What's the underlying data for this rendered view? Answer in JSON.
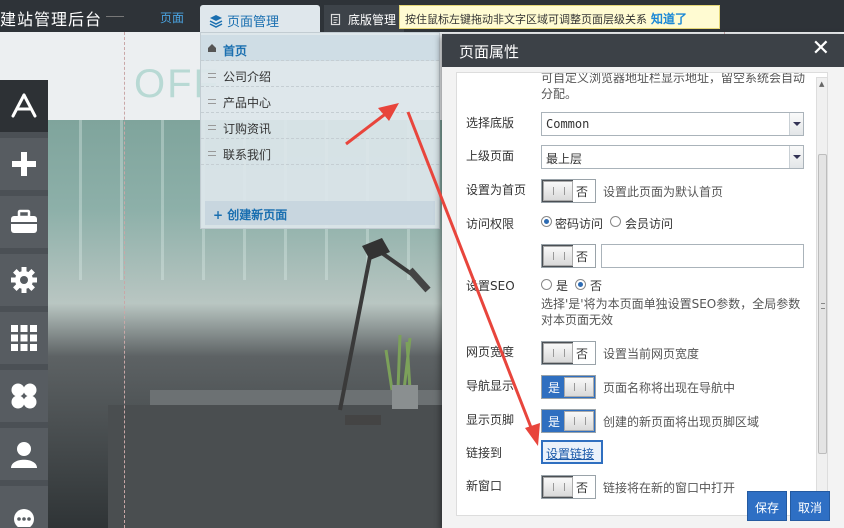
{
  "topbar": {
    "site_title": "建站管理后台",
    "tabs": {
      "page": "页面",
      "page_mgmt": "页面管理",
      "template_mgmt": "底版管理"
    },
    "tip": {
      "text": "按住鼠标左键拖动非文字区域可调整页面层级关系",
      "ok": "知道了"
    }
  },
  "canvas": {
    "logo_text": "OFF"
  },
  "leftbar": {
    "icons": [
      "app-store-icon",
      "plus-icon",
      "toolbox-icon",
      "gear-icon",
      "grid-icon",
      "clover-icon",
      "user-icon",
      "more-icon"
    ]
  },
  "page_dropdown": {
    "items": [
      {
        "label": "首页",
        "home": true
      },
      {
        "label": "公司介绍"
      },
      {
        "label": "产品中心"
      },
      {
        "label": "订购资讯"
      },
      {
        "label": "联系我们"
      }
    ],
    "create_label": "+ 创建新页面"
  },
  "dialog": {
    "title": "页面属性",
    "top_hint_line1": "可自定义浏览器地址栏显示地址，留空系统会自动",
    "top_hint_line2": "分配。",
    "template": {
      "label": "选择底版",
      "value": "Common"
    },
    "parent": {
      "label": "上级页面",
      "value": "最上层"
    },
    "home": {
      "label": "设置为首页",
      "toggle": "否",
      "hint": "设置此页面为默认首页"
    },
    "access": {
      "label": "访问权限",
      "opt1": "密码访问",
      "opt2": "会员访问",
      "selected": "密码访问",
      "toggle": "否",
      "password": ""
    },
    "seo": {
      "label": "设置SEO",
      "opt_yes": "是",
      "opt_no": "否",
      "selected": "否",
      "hint_line1": "选择'是'将为本页面单独设置SEO参数，全局参数",
      "hint_line2": "对本页面无效"
    },
    "width": {
      "label": "网页宽度",
      "toggle": "否",
      "hint": "设置当前网页宽度"
    },
    "nav": {
      "label": "导航显示",
      "toggle": "是",
      "hint": "页面名称将出现在导航中"
    },
    "footer": {
      "label": "显示页脚",
      "toggle": "是",
      "hint": "创建的新页面将出现页脚区域"
    },
    "link": {
      "label": "链接到",
      "button": "设置链接"
    },
    "new_window": {
      "label": "新窗口",
      "toggle": "否",
      "hint": "链接将在新的窗口中打开"
    },
    "save": "保存",
    "cancel": "取消"
  },
  "colors": {
    "accent": "#2e6fc4",
    "header_dark": "#3c4147",
    "tip_bg": "#fffbd2",
    "arrow": "#e8453c"
  }
}
